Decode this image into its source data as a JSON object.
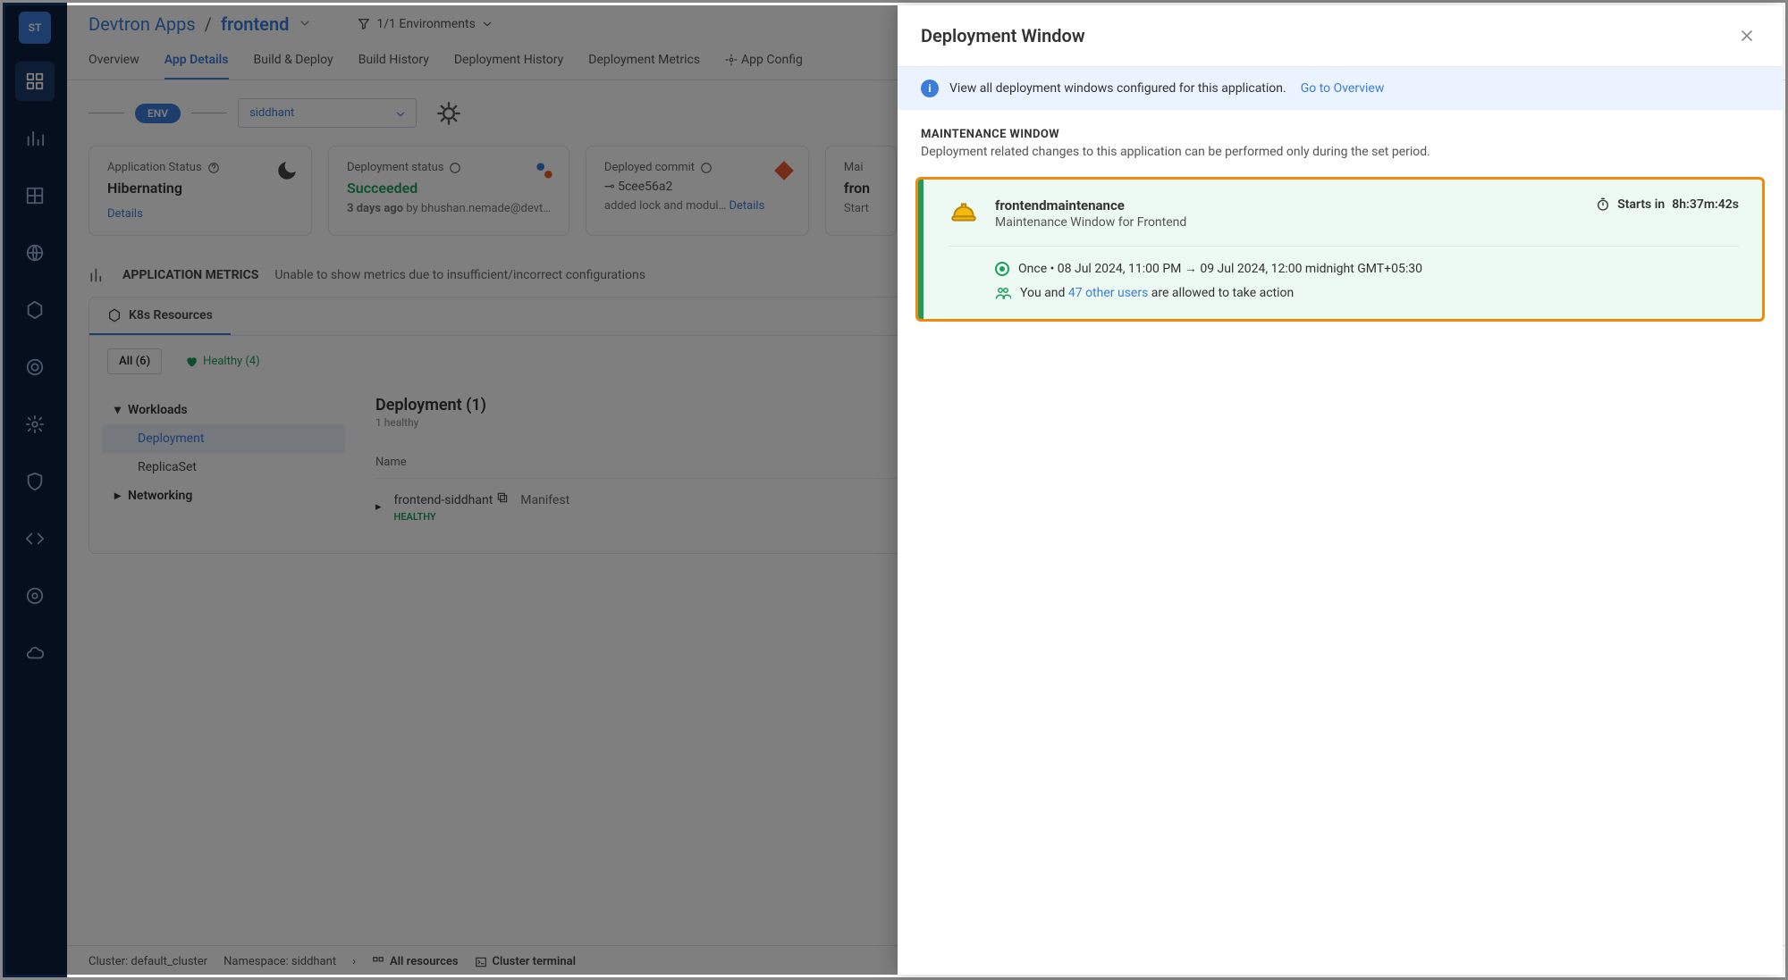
{
  "sidebar": {
    "logo_text": "ST"
  },
  "breadcrumb": {
    "root": "Devtron Apps",
    "app": "frontend"
  },
  "env_filter": "1/1 Environments",
  "tabs": [
    "Overview",
    "App Details",
    "Build & Deploy",
    "Build History",
    "Deployment History",
    "Deployment Metrics",
    "App Config"
  ],
  "env": {
    "badge": "ENV",
    "selected": "siddhant"
  },
  "cards": {
    "status": {
      "label": "Application Status",
      "value": "Hibernating",
      "details": "Details"
    },
    "deploy": {
      "label": "Deployment status",
      "value": "Succeeded",
      "age": "3 days ago",
      "by": "by bhushan.nemade@devt…"
    },
    "commit": {
      "label": "Deployed commit",
      "sha": "5cee56a2",
      "msg": "added lock and modul…",
      "details": "Details"
    },
    "maint": {
      "label": "Mai",
      "value": "fron",
      "sub": "Start"
    }
  },
  "metrics": {
    "title": "APPLICATION METRICS",
    "msg": "Unable to show metrics due to insufficient/incorrect configurations"
  },
  "resources": {
    "tab": "K8s Resources",
    "chips": {
      "all": "All (6)",
      "healthy": "Healthy (4)"
    },
    "tree": {
      "workloads": "Workloads",
      "deployment": "Deployment",
      "replicaset": "ReplicaSet",
      "networking": "Networking"
    },
    "content": {
      "title": "Deployment (1)",
      "sub": "1 healthy",
      "col": "Name",
      "row_name": "frontend-siddhant",
      "manifest": "Manifest",
      "health": "HEALTHY"
    }
  },
  "footer": {
    "cluster": "Cluster: default_cluster",
    "ns": "Namespace: siddhant",
    "all": "All resources",
    "term": "Cluster terminal"
  },
  "drawer": {
    "title": "Deployment Window",
    "banner_text": "View all deployment windows configured for this application.",
    "banner_link": "Go to Overview",
    "section_title": "MAINTENANCE WINDOW",
    "section_sub": "Deployment related changes to this application can be performed only during the set period.",
    "window": {
      "name": "frontendmaintenance",
      "desc": "Maintenance Window for Frontend",
      "timer_label": "Starts in",
      "timer_value": "8h:37m:42s",
      "schedule": "Once • 08 Jul 2024, 11:00 PM → 09 Jul 2024, 12:00 midnight GMT+05:30",
      "perm_pre": "You and ",
      "perm_link": "47 other users",
      "perm_post": " are allowed to take action"
    }
  }
}
